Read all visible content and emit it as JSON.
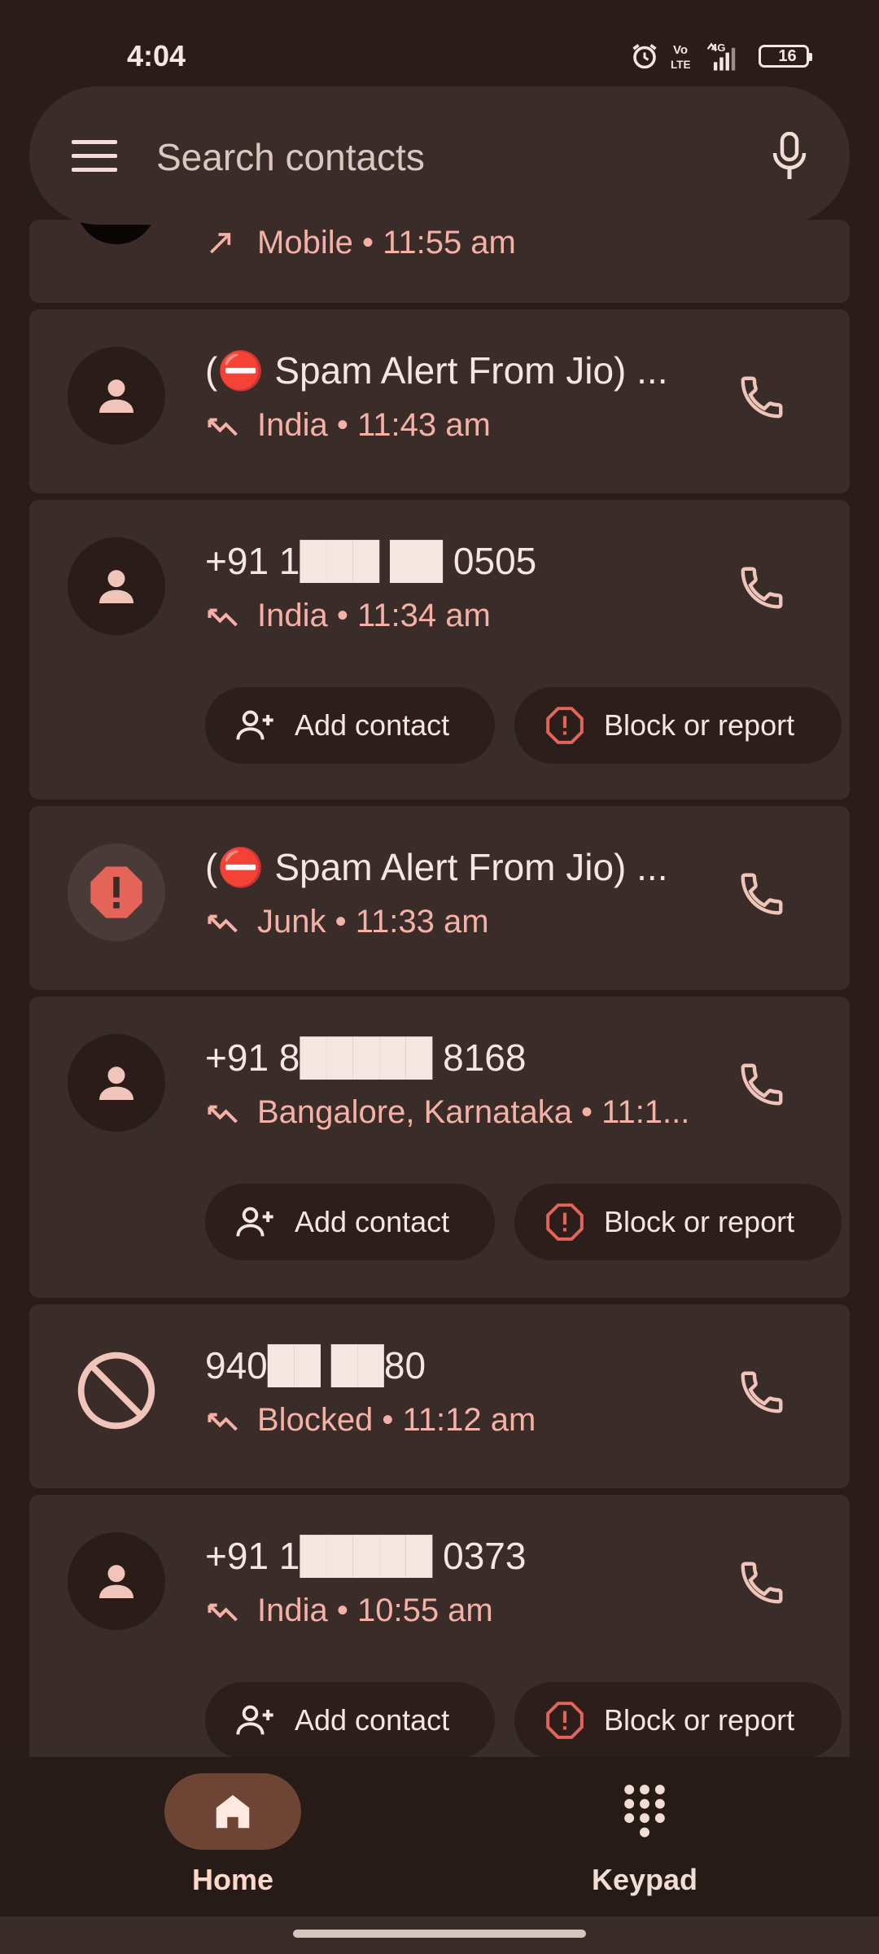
{
  "status_bar": {
    "time": "4:04",
    "battery": "16",
    "battery_fraction": 0.16,
    "network": "4G",
    "volte": "Vo LTE"
  },
  "search": {
    "placeholder": "Search contacts"
  },
  "call_log": [
    {
      "name": "",
      "subtitle": "Mobile • 11:55 am",
      "type": "partial"
    },
    {
      "name": "(⛔ Spam Alert From Jio) ...",
      "subtitle": "India • 11:43 am",
      "avatar": "person-icon"
    },
    {
      "name": "+91 1███ ██ 0505",
      "subtitle": "India • 11:34 am",
      "avatar": "person-icon",
      "actions": [
        "Add contact",
        "Block or report"
      ]
    },
    {
      "name": "(⛔ Spam Alert From Jio) ...",
      "subtitle": "Junk • 11:33 am",
      "avatar": "spam-warning-icon"
    },
    {
      "name": "+91 8█████ 8168",
      "subtitle": "Bangalore, Karnataka • 11:1...",
      "avatar": "person-icon",
      "actions": [
        "Add contact",
        "Block or report"
      ]
    },
    {
      "name": "940██ ██80",
      "subtitle": "Blocked • 11:12 am",
      "avatar": "blocked-icon"
    },
    {
      "name": "+91 1█████ 0373",
      "subtitle": "India • 10:55 am",
      "avatar": "person-icon",
      "actions": [
        "Add contact",
        "Block or report"
      ]
    }
  ],
  "bottom_nav": {
    "home_label": "Home",
    "keypad_label": "Keypad"
  },
  "colors": {
    "background": "#291c19",
    "card": "#3a2c29",
    "accent": "#f5b1a6",
    "spam_red": "#e5645a",
    "nav_active": "#6e4435"
  }
}
